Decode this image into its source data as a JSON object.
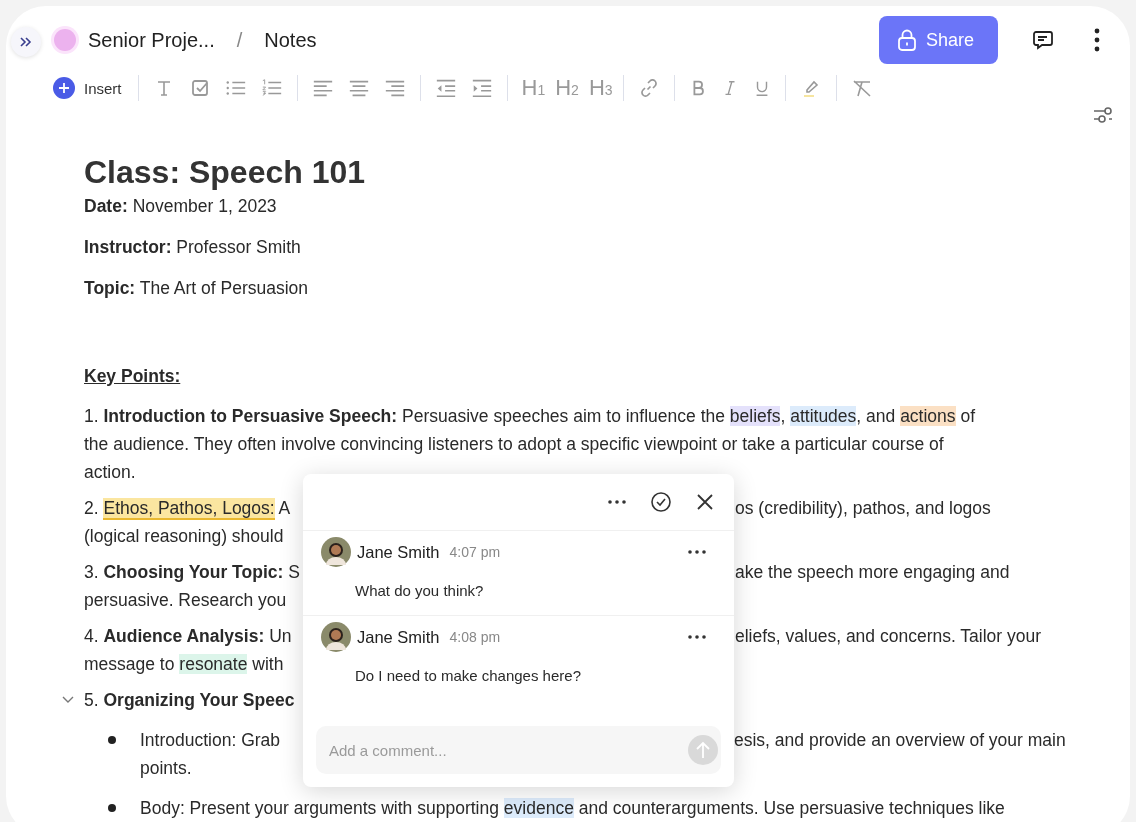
{
  "header": {
    "project": {
      "name": "Senior Proje...",
      "color": "#ecb2ee"
    },
    "separator": "/",
    "page": "Notes",
    "share": "Share"
  },
  "toolbar": {
    "insert": "Insert",
    "headings": [
      "H$_{1}$",
      "H$_{2}$",
      "H$_{3}$"
    ]
  },
  "document": {
    "title": "Class: Speech 101",
    "meta": [
      {
        "label": "Date:",
        "value": "November 1, 2023"
      },
      {
        "label": "Instructor:",
        "value": "Professor Smith"
      },
      {
        "label": "Topic:",
        "value": "The Art of Persuasion"
      }
    ],
    "section": "Key Points:",
    "items": [
      {
        "kind": "numbered",
        "lines": [
          {
            "left": [
              {
                "text": "1. **Introduction to Persuasive Speech:** Persuasive speeches aim to influence the "
              },
              {
                "text": "beliefs",
                "color": "#e4e1fb"
              },
              {
                "text": ", "
              },
              {
                "text": "attitudes",
                "color": "#dcebfb"
              },
              {
                "text": ", and "
              },
              {
                "text": "actions",
                "color": "#fbe0c4"
              },
              {
                "text": " of"
              }
            ]
          },
          {
            "left": [
              {
                "text": "the audience. They often involve convincing listeners to adopt a specific viewpoint or take a particular course of"
              }
            ]
          },
          {
            "left": [
              {
                "text": "action."
              }
            ]
          }
        ]
      },
      {
        "kind": "numbered",
        "lines": [
          {
            "left": [
              {
                "text": "2. "
              },
              {
                "text": "Ethos, Pathos, Logos:",
                "color": "#fbe6a0",
                "commented": true
              },
              {
                "text": " A"
              }
            ],
            "right": [
              {
                "text": "os (credibility), pathos, and logos"
              }
            ]
          },
          {
            "left": [
              {
                "text": "(logical reasoning) should"
              }
            ]
          }
        ]
      },
      {
        "kind": "numbered",
        "lines": [
          {
            "left": [
              {
                "text": "3. **Choosing Your Topic:** S"
              }
            ],
            "right": [
              {
                "text": "ake the speech more engaging and"
              }
            ]
          },
          {
            "left": [
              {
                "text": "persuasive. Research you"
              }
            ]
          }
        ]
      },
      {
        "kind": "numbered",
        "lines": [
          {
            "left": [
              {
                "text": "4. **Audience Analysis:** Un"
              }
            ],
            "right": [
              {
                "text": "eliefs, values, and concerns. Tailor your"
              }
            ]
          },
          {
            "left": [
              {
                "text": "message to "
              },
              {
                "text": "resonate",
                "color": "#dcf5ea"
              },
              {
                "text": " with"
              }
            ]
          }
        ]
      },
      {
        "kind": "collapsible",
        "expanded": true,
        "lines": [
          {
            "left": [
              {
                "text": "5. **Organizing Your Speec**"
              }
            ]
          }
        ],
        "children": [
          {
            "kind": "bullet",
            "lines": [
              {
                "left": [
                  {
                    "text": "Introduction: Grab"
                  }
                ],
                "right": [
                  {
                    "text": "esis, and provide an overview of your main"
                  }
                ]
              },
              {
                "left": [
                  {
                    "text": "points."
                  }
                ]
              }
            ]
          },
          {
            "kind": "bullet",
            "lines": [
              {
                "left": [
                  {
                    "text": "Body: Present your arguments with supporting "
                  },
                  {
                    "text": "evidence",
                    "color": "#dcebfb"
                  },
                  {
                    "text": " and counterarguments. Use persuasive techniques like"
                  }
                ]
              }
            ]
          }
        ]
      }
    ]
  },
  "comment_popup": {
    "comments": [
      {
        "author": "Jane Smith",
        "time": "4:07 pm",
        "body": "What do you think?"
      },
      {
        "author": "Jane Smith",
        "time": "4:08 pm",
        "body": "Do I need to make changes here?"
      }
    ],
    "input": {
      "placeholder": "Add a comment..."
    }
  }
}
